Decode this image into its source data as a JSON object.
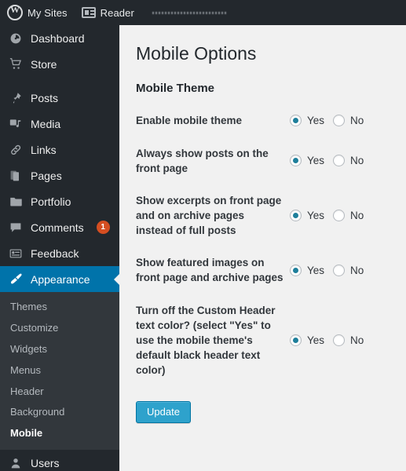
{
  "adminbar": {
    "wp_logo_icon": "wordpress-logo-icon",
    "my_sites_label": "My Sites",
    "reader_icon": "reader-feed-icon",
    "reader_label": "Reader"
  },
  "sidebar": {
    "items": [
      {
        "label": "Dashboard",
        "icon": "dashboard-icon",
        "glyph": "◑",
        "current": false,
        "spaced": false
      },
      {
        "label": "Store",
        "icon": "cart-icon",
        "glyph": "🛒",
        "current": false,
        "spaced": false
      },
      {
        "label": "Posts",
        "icon": "pin-icon",
        "glyph": "📌",
        "current": false,
        "spaced": true
      },
      {
        "label": "Media",
        "icon": "media-icon",
        "glyph": "♫",
        "current": false,
        "spaced": false
      },
      {
        "label": "Links",
        "icon": "link-icon",
        "glyph": "🔗",
        "current": false,
        "spaced": false
      },
      {
        "label": "Pages",
        "icon": "pages-icon",
        "glyph": "❏",
        "current": false,
        "spaced": false
      },
      {
        "label": "Portfolio",
        "icon": "portfolio-icon",
        "glyph": "🗂",
        "current": false,
        "spaced": false
      },
      {
        "label": "Comments",
        "icon": "comment-icon",
        "glyph": "💬",
        "current": false,
        "spaced": false,
        "badge": "1"
      },
      {
        "label": "Feedback",
        "icon": "feedback-icon",
        "glyph": "▤",
        "current": false,
        "spaced": false
      },
      {
        "label": "Appearance",
        "icon": "appearance-brush-icon",
        "glyph": "🖌",
        "current": true,
        "spaced": false
      }
    ],
    "submenu": [
      {
        "label": "Themes",
        "active": false
      },
      {
        "label": "Customize",
        "active": false
      },
      {
        "label": "Widgets",
        "active": false
      },
      {
        "label": "Menus",
        "active": false
      },
      {
        "label": "Header",
        "active": false
      },
      {
        "label": "Background",
        "active": false
      },
      {
        "label": "Mobile",
        "active": true
      }
    ],
    "users_item": {
      "label": "Users",
      "icon": "users-icon",
      "glyph": "👤"
    }
  },
  "main": {
    "page_title": "Mobile Options",
    "section_title": "Mobile Theme",
    "yes_label": "Yes",
    "no_label": "No",
    "options": [
      {
        "label": "Enable mobile theme",
        "value": "Yes"
      },
      {
        "label": "Always show posts on the front page",
        "value": "Yes"
      },
      {
        "label": "Show excerpts on front page and on archive pages instead of full posts",
        "value": "Yes"
      },
      {
        "label": "Show featured images on front page and archive pages",
        "value": "Yes"
      },
      {
        "label": "Turn off the Custom Header text color? (select \"Yes\" to use the mobile theme's default black header text color)",
        "value": "Yes"
      }
    ],
    "update_label": "Update"
  },
  "colors": {
    "admin_dark": "#23282d",
    "submenu_dark": "#32373c",
    "accent_blue": "#0073aa",
    "button_blue": "#2ea2cc",
    "radio_teal": "#1e7f9b",
    "badge_orange": "#d54e21",
    "content_bg": "#f1f1f1"
  }
}
